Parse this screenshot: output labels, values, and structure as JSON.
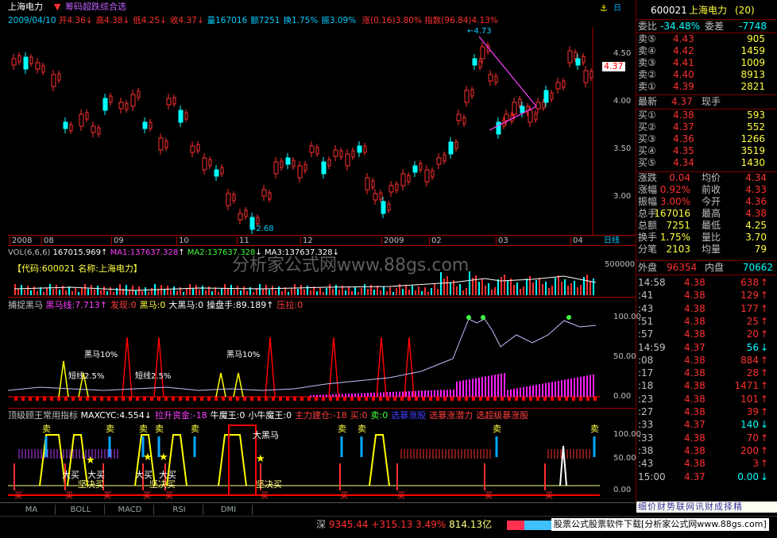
{
  "header": {
    "stock_name": "上海电力",
    "formula_name": "筹码超跌综合选",
    "date": "2009/04/10",
    "ohlc": [
      {
        "label": "开",
        "value": "4.36",
        "arrow": "↓",
        "color": "#ff3030"
      },
      {
        "label": "高",
        "value": "4.38",
        "arrow": "↓",
        "color": "#ff3030"
      },
      {
        "label": "低",
        "value": "4.25",
        "arrow": "↓",
        "color": "#ff3030"
      },
      {
        "label": "收",
        "value": "4.37",
        "arrow": "↓",
        "color": "#ff3030"
      },
      {
        "label": "量",
        "value": "167016",
        "arrow": "",
        "color": "#00ccff"
      },
      {
        "label": "额",
        "value": "7251",
        "arrow": "",
        "color": "#00ccff"
      },
      {
        "label": "换",
        "value": "1.75%",
        "arrow": "",
        "color": "#00ccff"
      },
      {
        "label": "振",
        "value": "3.09%",
        "arrow": "",
        "color": "#00ccff"
      }
    ],
    "change": "涨(0.16)3.80%",
    "index_info": "指数(96.84)4.13%"
  },
  "price_chart": {
    "y_ticks": [
      "4.50",
      "4.00",
      "3.50",
      "3.00"
    ],
    "current_price": "4.37",
    "high_label": "4.73",
    "low_label": "2.68",
    "x_labels": [
      "2008",
      "08",
      "09",
      "10",
      "11",
      "12",
      "2009",
      "02",
      "03",
      "04"
    ],
    "x_axis_right": "日线"
  },
  "volume_panel": {
    "label": "VOL(6,6,6)",
    "value": "167015.969",
    "ma1": "MA1:137637.328",
    "ma2": "MA2:137637.328",
    "ma3": "MA3:137637.328",
    "code_label": "【代码:600021 名称:上海电力】",
    "watermark": "分析家公式网www.88gs.com",
    "y_tick": "500000"
  },
  "catch_panel": {
    "title": "捕捉黑马",
    "items": [
      {
        "text": "黑马线:7.713↑",
        "color": "#ff40ff"
      },
      {
        "text": "发现:0",
        "color": "#ff4040"
      },
      {
        "text": "黑马:0",
        "color": "#ffff40"
      },
      {
        "text": "大黑马:0",
        "color": "#ffffff"
      },
      {
        "text": "操盘手:89.189↑",
        "color": "#ffffff"
      },
      {
        "text": "压拉:0",
        "color": "#ff4040"
      }
    ],
    "y_ticks": [
      "100.00",
      "50.00",
      "0.00"
    ],
    "annotations": [
      "黑马10%",
      "短线2.5%",
      "短线2.5%",
      "黑马10%"
    ]
  },
  "top_panel": {
    "title": "顶级顾王常用指标",
    "items": [
      {
        "text": "MAXCYC:4.554↓",
        "color": "#ffffff"
      },
      {
        "text": "拉升资金:-18",
        "color": "#ff40ff"
      },
      {
        "text": "牛魔王:0",
        "color": "#ffffff"
      },
      {
        "text": "小牛魔王:0",
        "color": "#ffffff"
      },
      {
        "text": "主力建仓:-18",
        "color": "#ff4040"
      },
      {
        "text": "买:0",
        "color": "#ff4040"
      },
      {
        "text": "卖:0",
        "color": "#40ff40"
      },
      {
        "text": "选暴涨股",
        "color": "#4040ff"
      },
      {
        "text": "选暴涨潜力",
        "color": "#ff4040"
      },
      {
        "text": "选超级暴涨股",
        "color": "#ff4040"
      }
    ],
    "y_ticks": [
      "100.00",
      "50.00",
      "0.00"
    ],
    "sell_label": "卖",
    "buy_label": "买",
    "big_horse": "大黑马",
    "big_buy": "大买",
    "decisive_buy": "坚决买"
  },
  "side": {
    "code": "600021",
    "name": "上海电力",
    "num": "(20)",
    "ratio_label": "委比",
    "ratio": "-34.48%",
    "diff_label": "委差",
    "diff": "-7748",
    "asks": [
      {
        "label": "卖⑤",
        "price": "4.43",
        "vol": "905"
      },
      {
        "label": "卖④",
        "price": "4.42",
        "vol": "1459"
      },
      {
        "label": "卖③",
        "price": "4.41",
        "vol": "1009"
      },
      {
        "label": "卖②",
        "price": "4.40",
        "vol": "8913"
      },
      {
        "label": "卖①",
        "price": "4.39",
        "vol": "2821"
      }
    ],
    "last_label": "最新",
    "last": "4.37",
    "hand_label": "现手",
    "bids": [
      {
        "label": "买①",
        "price": "4.38",
        "vol": "593"
      },
      {
        "label": "买②",
        "price": "4.37",
        "vol": "552"
      },
      {
        "label": "买③",
        "price": "4.36",
        "vol": "1266"
      },
      {
        "label": "买④",
        "price": "4.35",
        "vol": "3519"
      },
      {
        "label": "买⑤",
        "price": "4.34",
        "vol": "1430"
      }
    ],
    "stats": [
      {
        "l1": "涨跌",
        "v1": "0.04",
        "l2": "均价",
        "v2": "4.34"
      },
      {
        "l1": "涨幅",
        "v1": "0.92%",
        "l2": "前收",
        "v2": "4.33"
      },
      {
        "l1": "振幅",
        "v1": "3.00%",
        "l2": "今开",
        "v2": "4.36"
      },
      {
        "l1": "总手",
        "v1": "167016",
        "l2": "最高",
        "v2": "4.38"
      },
      {
        "l1": "总额",
        "v1": "7251",
        "l2": "最低",
        "v2": "4.25"
      },
      {
        "l1": "换手",
        "v1": "1.75%",
        "l2": "量比",
        "v2": "3.70"
      },
      {
        "l1": "分笔",
        "v1": "2103",
        "l2": "均量",
        "v2": "79"
      }
    ],
    "outer_label": "外盘",
    "outer": "96354",
    "inner_label": "内盘",
    "inner": "70662",
    "ticks": [
      {
        "time": "14:58",
        "price": "4.38",
        "vol": "638",
        "arrow": "↑"
      },
      {
        "time": ":41",
        "price": "4.38",
        "vol": "129",
        "arrow": "↑"
      },
      {
        "time": ":43",
        "price": "4.38",
        "vol": "177",
        "arrow": "↑"
      },
      {
        "time": ":51",
        "price": "4.38",
        "vol": "25",
        "arrow": "↑"
      },
      {
        "time": ":57",
        "price": "4.38",
        "vol": "20",
        "arrow": "↑"
      },
      {
        "time": "14:59",
        "price": "4.37",
        "vol": "56",
        "arrow": "↓"
      },
      {
        "time": ":08",
        "price": "4.38",
        "vol": "884",
        "arrow": "↑"
      },
      {
        "time": ":17",
        "price": "4.38",
        "vol": "28",
        "arrow": "↑"
      },
      {
        "time": ":18",
        "price": "4.38",
        "vol": "1471",
        "arrow": "↑"
      },
      {
        "time": ":23",
        "price": "4.38",
        "vol": "101",
        "arrow": "↑"
      },
      {
        "time": ":27",
        "price": "4.38",
        "vol": "39",
        "arrow": "↑"
      },
      {
        "time": ":33",
        "price": "4.37",
        "vol": "140",
        "arrow": "↓"
      },
      {
        "time": ":33",
        "price": "4.38",
        "vol": "70",
        "arrow": "↑"
      },
      {
        "time": ":38",
        "price": "4.38",
        "vol": "200",
        "arrow": "↑"
      },
      {
        "time": ":43",
        "price": "4.38",
        "vol": "3",
        "arrow": "↑"
      },
      {
        "time": "15:00",
        "price": "4.37",
        "vol": "0.00",
        "arrow": "↓"
      }
    ],
    "tabs": "细价财势联网讯财成择精"
  },
  "bottom": {
    "tabs": [
      "MA",
      "BOLL",
      "MACD",
      "RSI",
      "DMI"
    ],
    "index_name": "深",
    "index_value": "9345.44",
    "index_change": "+315.13",
    "index_pct": "3.49%",
    "index_amount": "814.13亿",
    "ad": "股票公式股票软件下载[分析家公式网www.88gs.com]"
  },
  "colors": {
    "up": "#ff3030",
    "down": "#00ffff",
    "frame": "#7a0000",
    "axis": "#aa0000"
  }
}
